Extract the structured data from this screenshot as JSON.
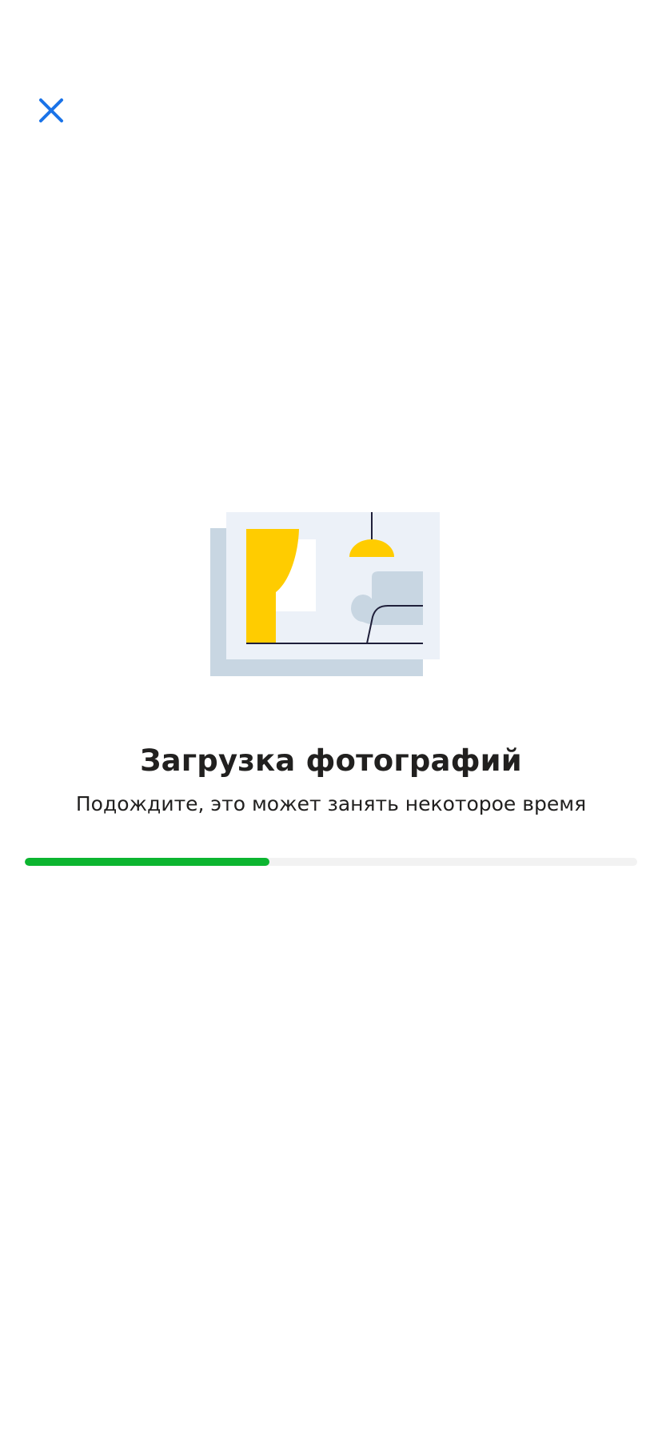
{
  "header": {
    "close_icon": "close-icon"
  },
  "illustration": {
    "icon": "room-photo-illustration",
    "colors": {
      "shadow": "#c8d6e2",
      "card": "#ecf1f8",
      "accent": "#ffcc00",
      "window": "#ffffff",
      "line": "#1f1f3a"
    }
  },
  "upload": {
    "title": "Загрузка фотографий",
    "subtitle": "Подождите, это может занять некоторое время",
    "progress": 0.4
  },
  "colors": {
    "close_icon": "#1a73e8",
    "progress_fill": "#0cb530",
    "progress_track": "#f2f2f2",
    "text": "#21201f"
  }
}
